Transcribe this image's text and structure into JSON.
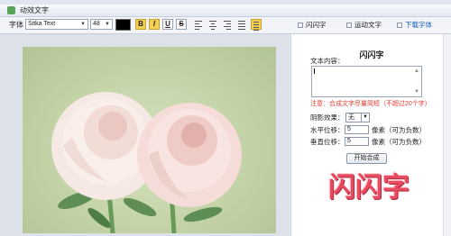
{
  "window": {
    "title": "动效文字"
  },
  "toolbar": {
    "font_label": "字体",
    "font_family": "Sitka Text",
    "font_size": "48",
    "color": "#000000",
    "bold": "B",
    "italic": "I",
    "underline": "U",
    "strike": "S"
  },
  "tabs": [
    {
      "label": "闪闪字"
    },
    {
      "label": "运动文字"
    },
    {
      "label": "下载字体"
    }
  ],
  "panel": {
    "heading": "闪闪字",
    "content_label": "文本内容：",
    "content_value": "",
    "warning": "注意：合成文字尽量简短（不超过20个字）",
    "shadow_label": "阴影效果：",
    "shadow_value": "无",
    "h_offset_label": "水平位移：",
    "h_offset_value": "5",
    "h_offset_unit": "像素（可为负数）",
    "v_offset_label": "垂直位移：",
    "v_offset_value": "5",
    "v_offset_unit": "像素（可为负数）",
    "generate_button": "开始合成",
    "preview_text": "闪闪字"
  }
}
